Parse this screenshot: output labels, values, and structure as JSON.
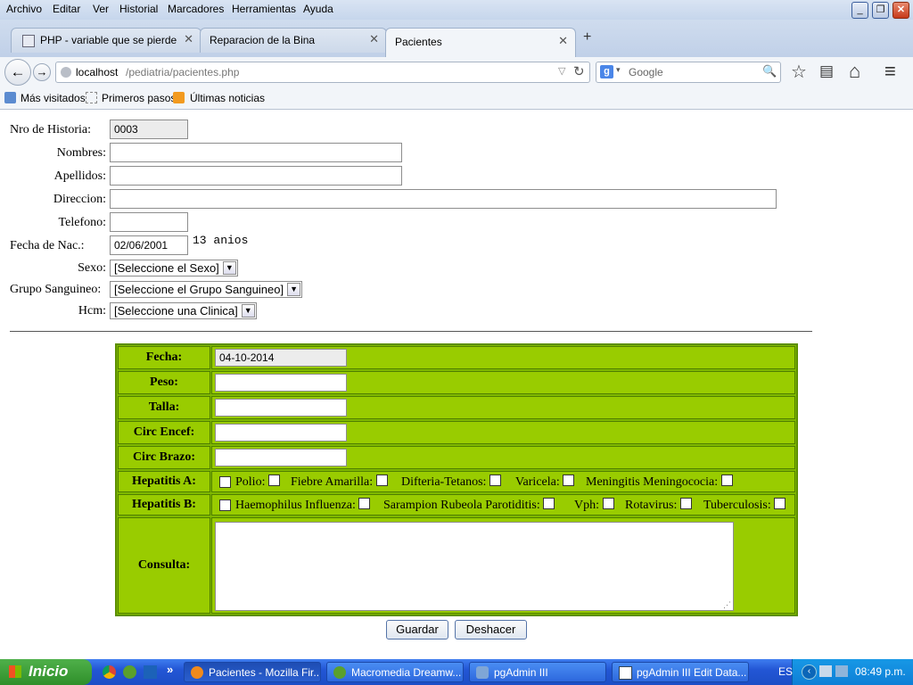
{
  "menubar": {
    "items": [
      "Archivo",
      "Editar",
      "Ver",
      "Historial",
      "Marcadores",
      "Herramientas",
      "Ayuda"
    ],
    "window_controls": {
      "minimize": "_",
      "restore": "❐",
      "close": "✕"
    }
  },
  "tabs": [
    {
      "label": "PHP - variable que se pierde",
      "close": "✕"
    },
    {
      "label": "Reparacion de la Bina",
      "close": "✕"
    },
    {
      "label": "Pacientes",
      "close": "✕"
    }
  ],
  "tab_add": "+",
  "navbar": {
    "back": "←",
    "forward": "→",
    "url_host": "localhost",
    "url_path": "/pediatria/pacientes.php",
    "dropdown": "▽",
    "reload": "↻",
    "search_engine": "g",
    "search_placeholder": "Google",
    "search_icon": "🔍",
    "bookmark_star": "☆",
    "reading_list": "▤",
    "home": "⌂",
    "menu": "≡"
  },
  "bookmarks": [
    "Más visitados",
    "Primeros pasos",
    "Últimas noticias"
  ],
  "form": {
    "nro_label": "Nro de Historia:",
    "nro_value": "0003",
    "nombres_label": "Nombres:",
    "nombres_value": "",
    "apellidos_label": "Apellidos:",
    "apellidos_value": "",
    "direccion_label": "Direccion:",
    "direccion_value": "",
    "telefono_label": "Telefono:",
    "telefono_value": "",
    "fecha_nac_label": "Fecha de Nac.:",
    "fecha_nac_value": "02/06/2001",
    "edad": "13 anios",
    "sexo_label": "Sexo:",
    "sexo_value": "[Seleccione el Sexo]",
    "grupo_label": "Grupo Sanguineo:",
    "grupo_value": "[Seleccione el Grupo Sanguineo]",
    "hcm_label": "Hcm:",
    "hcm_value": "[Seleccione una Clinica]"
  },
  "consulta": {
    "fecha_label": "Fecha:",
    "fecha_value": "04-10-2014",
    "peso_label": "Peso:",
    "talla_label": "Talla:",
    "circ_encef_label": "Circ Encef:",
    "circ_brazo_label": "Circ Brazo:",
    "row_a_label": "Hepatitis A:",
    "row_a_items": [
      "Polio:",
      "Fiebre Amarilla:",
      "Difteria-Tetanos:",
      "Varicela:",
      "Meningitis Meningococia:"
    ],
    "row_b_label": "Hepatitis B:",
    "row_b_items": [
      "Haemophilus Influenza:",
      "Sarampion Rubeola Parotiditis:",
      "Vph:",
      "Rotavirus:",
      "Tuberculosis:"
    ],
    "consulta_label": "Consulta:",
    "consulta_value": ""
  },
  "buttons": {
    "guardar": "Guardar",
    "deshacer": "Deshacer"
  },
  "taskbar": {
    "start": "Inicio",
    "tasks": [
      "Pacientes - Mozilla Fir...",
      "Macromedia Dreamw...",
      "pgAdmin III",
      "pgAdmin III Edit Data..."
    ],
    "lang": "ES",
    "clock": "08:49 p.m.",
    "overflow": "»"
  },
  "colors": {
    "form_green": "#99cc00",
    "form_border": "#4f7f00",
    "taskbar_blue": "#2356d5"
  }
}
